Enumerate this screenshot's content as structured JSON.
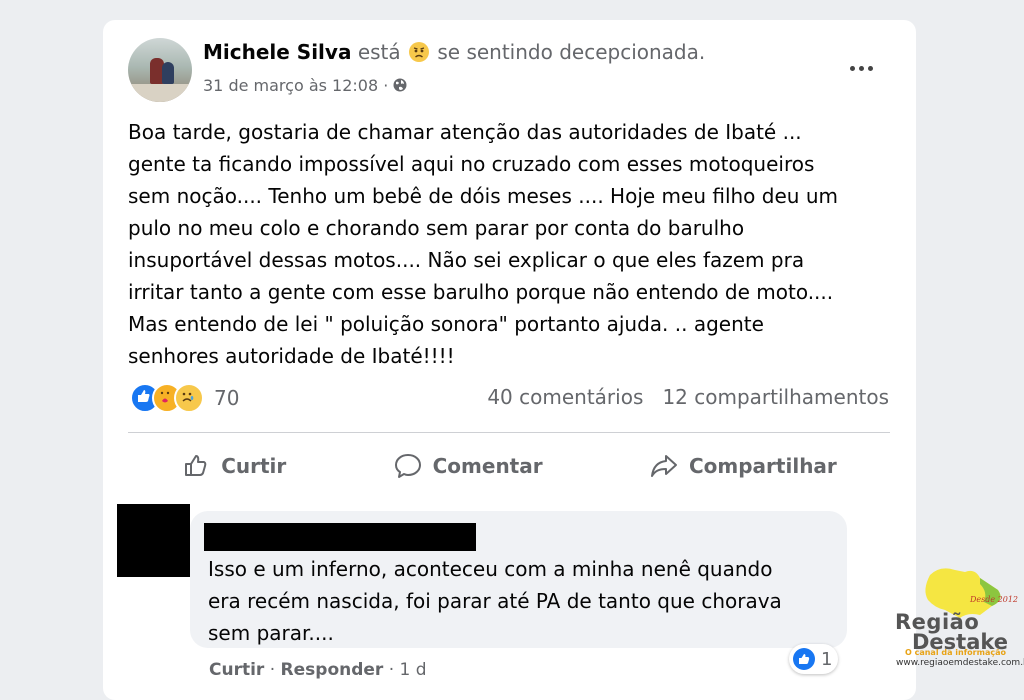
{
  "post": {
    "author": "Michele Silva",
    "feeling_prefix": "está",
    "feeling": "se sentindo decepcionada.",
    "timestamp": "31 de março às 12:08 ·",
    "text": "Boa tarde, gostaria de chamar atenção das autoridades de Ibaté ...\ngente ta ficando impossível aqui no cruzado com esses motoqueiros\nsem noção.... Tenho um bebê de dóis meses .... Hoje meu filho deu um\npulo no meu colo e chorando sem parar por conta do barulho\ninsuportável dessas motos.... Não sei explicar o que eles fazem pra\nirritar tanto a gente com esse barulho porque não entendo de moto....\nMas entendo de lei \" poluição sonora\" portanto ajuda. .. agente\nsenhores autoridade de Ibaté!!!!",
    "reaction_count": "70",
    "comments_count": "40 comentários",
    "shares_count": "12 compartilhamentos"
  },
  "actions": {
    "like": "Curtir",
    "comment": "Comentar",
    "share": "Compartilhar"
  },
  "comment": {
    "text": "Isso e um inferno, aconteceu com a minha nenê quando\nera recém nascida, foi parar até PA de tanto que chorava\nsem parar....",
    "reaction_count": "1",
    "like_label": "Curtir",
    "reply_label": "Responder",
    "age": "· 1 d"
  },
  "watermark": {
    "name_line1": "Região",
    "name_line2": "Destake",
    "tagline": "O canal da informação",
    "url": "www.regiaoemdestake.com.br",
    "badge": "Desde 2012"
  },
  "colors": {
    "like_blue": "#1877f2",
    "muted_text": "#65676b",
    "bubble_bg": "#f0f2f5",
    "logo_yellow": "#f5e642",
    "logo_green": "#8cc63f"
  }
}
